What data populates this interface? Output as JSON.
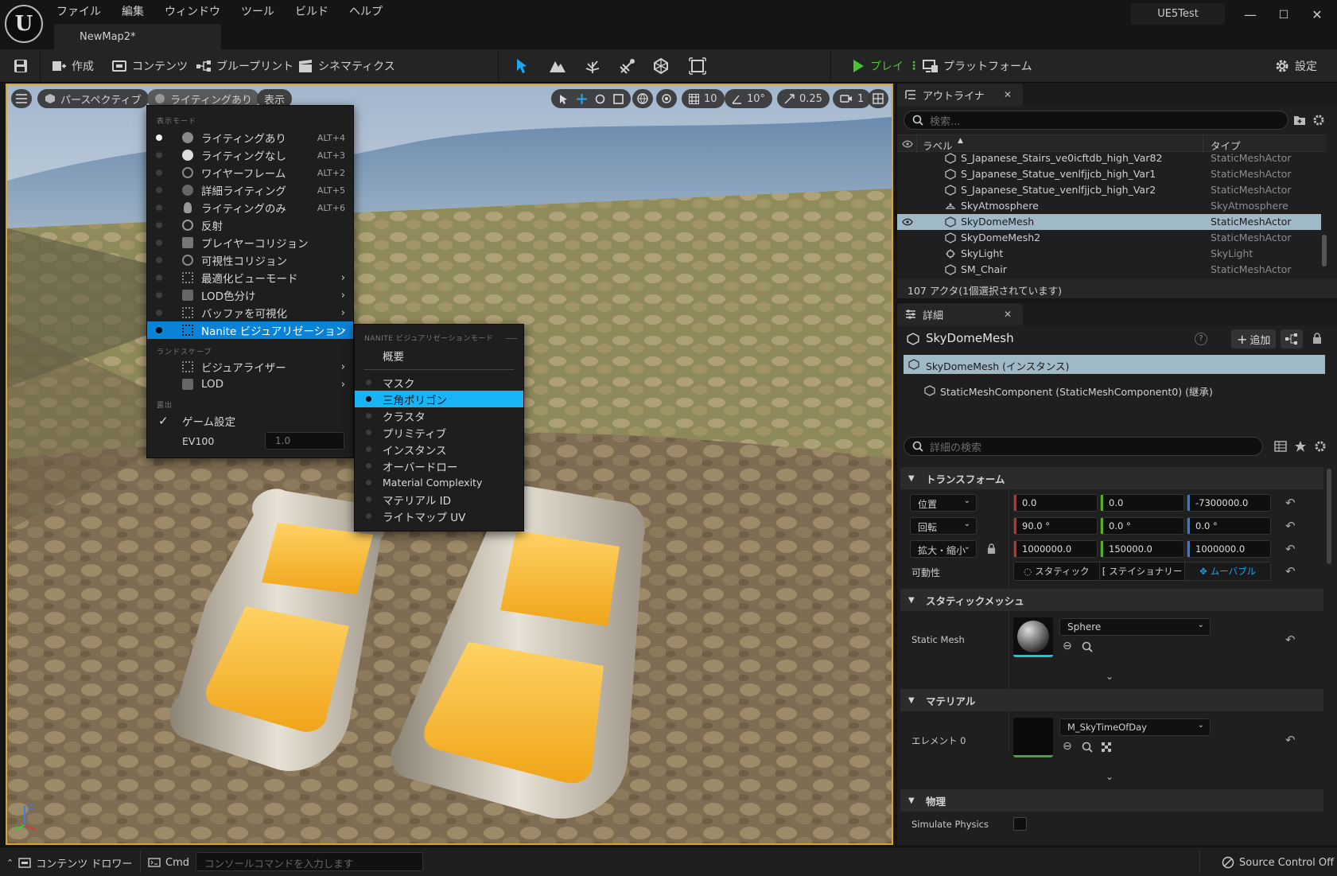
{
  "app": {
    "menus": [
      "ファイル",
      "編集",
      "ウィンドウ",
      "ツール",
      "ビルド",
      "ヘルプ"
    ],
    "document_tab": "NewMap2*",
    "project_name": "UE5Test"
  },
  "toolbar": {
    "create": "作成",
    "content": "コンテンツ",
    "blueprint": "ブループリント",
    "cinematics": "シネマティクス",
    "play": "プレイ",
    "platform": "プラットフォーム",
    "settings": "設定"
  },
  "viewport": {
    "perspective": "パースペクティブ",
    "lighting": "ライティングあり",
    "show": "表示",
    "grid_snap": "10",
    "rotation_snap": "10°",
    "scale_snap": "0.25",
    "camera_speed": "1"
  },
  "view_mode_menu": {
    "section_view_mode": "表示モード",
    "items": [
      {
        "label": "ライティングあり",
        "shortcut": "ALT+4",
        "selected": true
      },
      {
        "label": "ライティングなし",
        "shortcut": "ALT+3"
      },
      {
        "label": "ワイヤーフレーム",
        "shortcut": "ALT+2"
      },
      {
        "label": "詳細ライティング",
        "shortcut": "ALT+5"
      },
      {
        "label": "ライティングのみ",
        "shortcut": "ALT+6"
      },
      {
        "label": "反射",
        "shortcut": ""
      },
      {
        "label": "プレイヤーコリジョン",
        "shortcut": ""
      },
      {
        "label": "可視性コリジョン",
        "shortcut": ""
      },
      {
        "label": "最適化ビューモード",
        "submenu": true
      },
      {
        "label": "LOD色分け",
        "submenu": true
      },
      {
        "label": "バッファを可視化",
        "submenu": true
      },
      {
        "label": "Nanite ビジュアリゼーション",
        "submenu": true,
        "highlighted": true
      }
    ],
    "section_landscape": "ランドスケープ",
    "landscape_items": [
      {
        "label": "ビジュアライザー"
      },
      {
        "label": "LOD"
      }
    ],
    "section_exposure": "露出",
    "game_settings": "ゲーム設定",
    "ev100_label": "EV100",
    "ev100_value": "1.0"
  },
  "nanite_menu": {
    "header": "NANITE ビジュアリゼーションモード",
    "overview": "概要",
    "items": [
      {
        "label": "マスク"
      },
      {
        "label": "三角ポリゴン",
        "selected": true
      },
      {
        "label": "クラスタ"
      },
      {
        "label": "プリミティブ"
      },
      {
        "label": "インスタンス"
      },
      {
        "label": "オーバードロー"
      },
      {
        "label": "Material Complexity"
      },
      {
        "label": "マテリアル ID"
      },
      {
        "label": "ライトマップ UV"
      }
    ]
  },
  "outliner": {
    "tab": "アウトライナ",
    "search_placeholder": "検索...",
    "col_label": "ラベル",
    "col_type": "タイプ",
    "rows": [
      {
        "name": "S_Japanese_Stairs_ve0icftdb_high_Var82",
        "type": "StaticMeshActor"
      },
      {
        "name": "S_Japanese_Statue_venlfjjcb_high_Var1",
        "type": "StaticMeshActor"
      },
      {
        "name": "S_Japanese_Statue_venlfjjcb_high_Var2",
        "type": "StaticMeshActor"
      },
      {
        "name": "SkyAtmosphere",
        "type": "SkyAtmosphere"
      },
      {
        "name": "SkyDomeMesh",
        "type": "StaticMeshActor",
        "selected": true
      },
      {
        "name": "SkyDomeMesh2",
        "type": "StaticMeshActor"
      },
      {
        "name": "SkyLight",
        "type": "SkyLight"
      },
      {
        "name": "SM_Chair",
        "type": "StaticMeshActor"
      }
    ],
    "status": "107 アクタ(1個選択されています)"
  },
  "details": {
    "tab": "詳細",
    "actor_name": "SkyDomeMesh",
    "add_button": "追加",
    "instance_row": "SkyDomeMesh (インスタンス)",
    "component_row": "StaticMeshComponent (StaticMeshComponent0) (継承)",
    "search_placeholder": "詳細の検索",
    "transform": {
      "header": "トランスフォーム",
      "location_label": "位置",
      "location": [
        "0.0",
        "0.0",
        "-7300000.0"
      ],
      "rotation_label": "回転",
      "rotation": [
        "90.0 °",
        "0.0 °",
        "0.0 °"
      ],
      "scale_label": "拡大・縮小",
      "scale": [
        "1000000.0",
        "150000.0",
        "1000000.0"
      ],
      "mobility_label": "可動性",
      "mobility_options": [
        "スタティック",
        "ステイショナリー",
        "ムーバブル"
      ],
      "mobility_selected": "ムーバブル"
    },
    "static_mesh": {
      "header": "スタティックメッシュ",
      "label": "Static Mesh",
      "value": "Sphere"
    },
    "materials": {
      "header": "マテリアル",
      "label": "エレメント 0",
      "value": "M_SkyTimeOfDay"
    },
    "physics": {
      "header": "物理",
      "simulate_label": "Simulate Physics"
    }
  },
  "statusbar": {
    "content_drawer": "コンテンツ ドロワー",
    "cmd": "Cmd",
    "console_placeholder": "コンソールコマンドを入力します",
    "source_control": "Source Control Off"
  },
  "colors": {
    "accent_blue": "#0a82d6",
    "selection_cyan": "#19b4f5",
    "play_green": "#4bc331",
    "viewport_border": "#d8a42a"
  }
}
